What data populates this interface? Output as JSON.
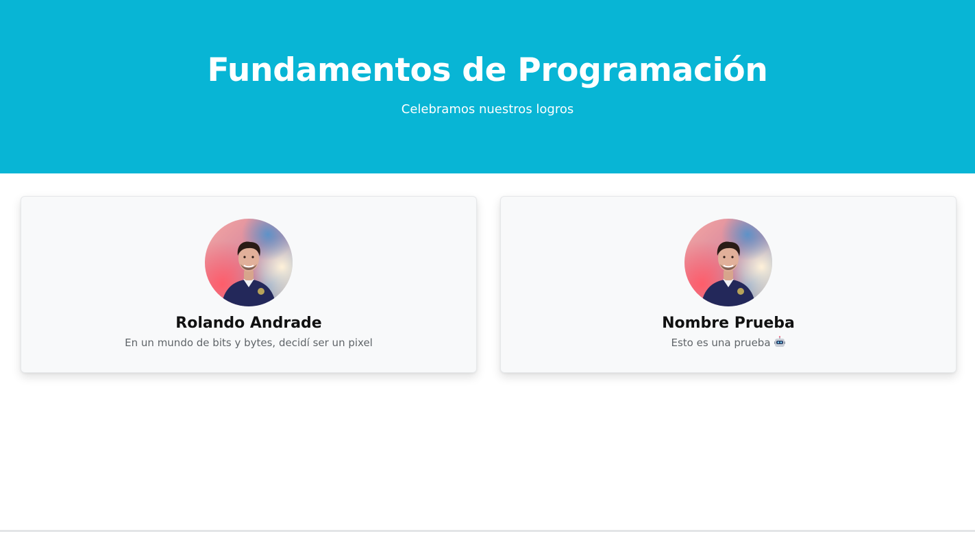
{
  "header": {
    "title": "Fundamentos de Programación",
    "subtitle": "Celebramos nuestros logros",
    "background_color": "#08b5d5"
  },
  "cards": [
    {
      "name": "Rolando Andrade",
      "text": "En un mundo de bits y bytes, decidí ser un pixel",
      "avatar_icon": "profile-photo"
    },
    {
      "name": "Nombre Prueba",
      "text": "Esto es una prueba",
      "emoji_icon": "robot-face-icon",
      "avatar_icon": "profile-photo"
    }
  ]
}
